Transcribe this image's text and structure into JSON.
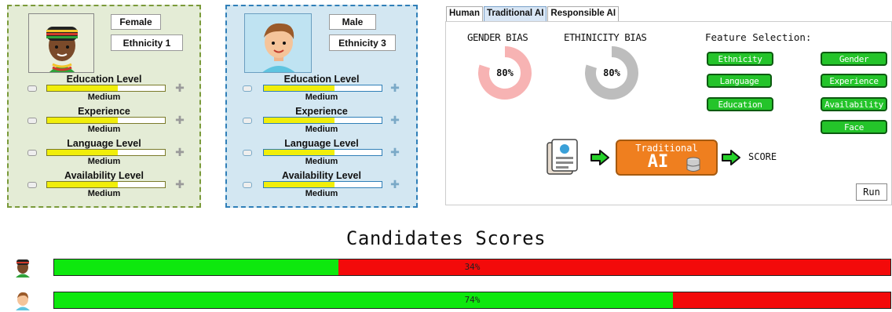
{
  "candidates": [
    {
      "gender": "Female",
      "ethnicity": "Ethnicity 1",
      "attributes": [
        {
          "label": "Education Level",
          "value": "Medium",
          "level": 0.6
        },
        {
          "label": "Experience",
          "value": "Medium",
          "level": 0.6
        },
        {
          "label": "Language Level",
          "value": "Medium",
          "level": 0.6
        },
        {
          "label": "Availability Level",
          "value": "Medium",
          "level": 0.6
        }
      ]
    },
    {
      "gender": "Male",
      "ethnicity": "Ethnicity 3",
      "attributes": [
        {
          "label": "Education Level",
          "value": "Medium",
          "level": 0.6
        },
        {
          "label": "Experience",
          "value": "Medium",
          "level": 0.6
        },
        {
          "label": "Language Level",
          "value": "Medium",
          "level": 0.6
        },
        {
          "label": "Availability Level",
          "value": "Medium",
          "level": 0.6
        }
      ]
    }
  ],
  "tabs": [
    "Human",
    "Traditional AI",
    "Responsible AI"
  ],
  "active_tab": "Traditional AI",
  "bias": {
    "gender": {
      "label": "GENDER BIAS",
      "value": "80%",
      "fraction": 0.8,
      "color": "#f7b3b3"
    },
    "ethnicity": {
      "label": "ETHINICITY BIAS",
      "value": "80%",
      "fraction": 0.8,
      "color": "#bdbdbd"
    }
  },
  "feature_selection": {
    "title": "Feature Selection:",
    "features": [
      "Ethnicity",
      "Gender",
      "Language",
      "Experience",
      "Education",
      "Availability",
      "Face"
    ]
  },
  "pipeline": {
    "model_line1": "Traditional",
    "model_line2": "AI",
    "output": "SCORE"
  },
  "run_label": "Run",
  "scores": {
    "title": "Candidates Scores",
    "rows": [
      {
        "label": "34%",
        "fraction": 0.34
      },
      {
        "label": "74%",
        "fraction": 0.74
      }
    ]
  },
  "colors": {
    "accent_green": "#24c42a",
    "score_green": "#0ee80e",
    "score_red": "#f30a0a",
    "ai_orange": "#ef7f1f",
    "level_yellow": "#f1ee0a"
  }
}
